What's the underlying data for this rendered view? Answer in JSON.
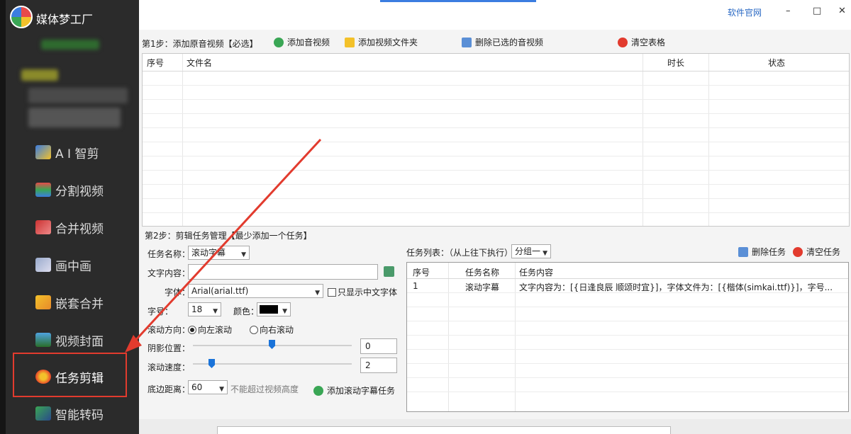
{
  "app": {
    "name": "媒体梦工厂"
  },
  "window": {
    "website": "软件官网",
    "minimize": "–",
    "maximize": "□",
    "close": "✕"
  },
  "sidebar": {
    "items": [
      {
        "label": "A I 智剪",
        "icon": "ai-cut-icon"
      },
      {
        "label": "分割视频",
        "icon": "split-video-icon"
      },
      {
        "label": "合并视频",
        "icon": "merge-video-icon"
      },
      {
        "label": "画中画",
        "icon": "picture-in-picture-icon"
      },
      {
        "label": "嵌套合并",
        "icon": "nested-merge-icon"
      },
      {
        "label": "视频封面",
        "icon": "video-cover-icon"
      },
      {
        "label": "任务剪辑",
        "icon": "task-edit-icon",
        "active": true
      },
      {
        "label": "智能转码",
        "icon": "smart-transcode-icon"
      }
    ]
  },
  "step1": {
    "title": "第1步：添加原音视频【必选】",
    "add_av": "添加音视频",
    "add_folder": "添加视频文件夹",
    "delete_selected": "删除已选的音视频",
    "clear_table": "清空表格"
  },
  "file_table": {
    "columns": [
      "序号",
      "文件名",
      "时长",
      "状态"
    ]
  },
  "step2": {
    "title": "第2步：剪辑任务管理【最少添加一个任务】"
  },
  "form": {
    "task_name_label": "任务名称：",
    "task_name_value": "滚动字幕",
    "text_label": "文字内容：",
    "text_value": "",
    "font_label": "字体：",
    "font_value": "Arial(arial.ttf)",
    "chinese_only": "只显示中文字体",
    "size_label": "字号：",
    "size_value": "18",
    "color_label": "颜色：",
    "color_value": "#000000",
    "direction_label": "滚动方向：",
    "dir_left": "向左滚动",
    "dir_right": "向右滚动",
    "shadow_label": "阴影位置：",
    "shadow_value": "0",
    "speed_label": "滚动速度：",
    "speed_value": "2",
    "bottom_label": "底边距离：",
    "bottom_value": "60",
    "bottom_hint": "不能超过视频高度",
    "add_task": "添加滚动字幕任务"
  },
  "task_list": {
    "label": "任务列表：（从上往下执行）",
    "group": "分组一",
    "delete_task": "删除任务",
    "clear_task": "清空任务",
    "columns": [
      "序号",
      "任务名称",
      "任务内容"
    ],
    "rows": [
      [
        "1",
        "滚动字幕",
        "文字内容为：[{日逢良辰 顺颂时宜}]，字体文件为：[{楷体(simkai.ttf)}]，字号..."
      ]
    ]
  }
}
